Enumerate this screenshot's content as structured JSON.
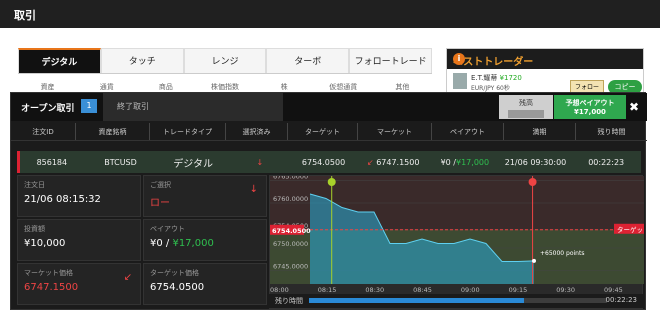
{
  "page": {
    "title": "取引"
  },
  "tabs": [
    "デジタル",
    "タッチ",
    "レンジ",
    "ターボ",
    "フォロートレード"
  ],
  "subheaders": [
    "資産",
    "通貨",
    "商品",
    "株価指数",
    "株",
    "仮想通貨",
    "其他"
  ],
  "best_trader": {
    "title": "ベストトレーダー",
    "info": "i",
    "name": "E.T.耀蒂",
    "amount": "¥1720",
    "pair": "EUR/JPY 60秒",
    "follow_label": "フォロー",
    "copy_label": "コピー"
  },
  "panel": {
    "open_tab": "オープン取引",
    "open_count": "1",
    "closed_tab": "終了取引",
    "balance_label": "残高",
    "payout_label": "予想ペイアウト",
    "payout_value": "¥17,000",
    "close_icon": "✖",
    "columns": [
      "注文ID",
      "資産銘柄",
      "トレードタイプ",
      "選択済み",
      "ターゲット",
      "マーケット",
      "ペイアウト",
      "満期",
      "残り時間"
    ],
    "row": {
      "id": "856184",
      "asset": "BTCUSD",
      "type": "デジタル",
      "direction": "↓",
      "target": "6754.0500",
      "market_arrow": "↙",
      "market": "6747.1500",
      "payout_a": "¥0 / ",
      "payout_b": "¥17,000",
      "expiry": "21/06 09:30:00",
      "remaining": "00:22:23"
    },
    "details": {
      "order_date_label": "注文日",
      "order_date": "21/06 08:15:32",
      "choice_label": "ご選択",
      "choice": "ロー",
      "invest_label": "投資額",
      "invest": "¥10,000",
      "payout_label": "ペイアウト",
      "payout_a": "¥0 / ",
      "payout_b": "¥17,000",
      "market_label": "マーケット価格",
      "market": "6747.1500",
      "target_label": "ターゲット価格",
      "target": "6754.0500"
    },
    "chart": {
      "y_labels": [
        "6765.0000",
        "6760.0000",
        "6754.0500",
        "6750.0000",
        "6745.0000"
      ],
      "x_labels": [
        "08:00",
        "08:15",
        "08:30",
        "08:45",
        "09:00",
        "09:15",
        "09:30",
        "09:45"
      ],
      "target_tag": "ターゲット",
      "annotation": "+65000 points",
      "accent": "#2aa4c9"
    },
    "remaining_label": "残り時間",
    "remaining_value": "00:22:23",
    "progress": 0.72
  },
  "chart_data": {
    "type": "line",
    "title": "",
    "x": [
      "08:00",
      "08:05",
      "08:10",
      "08:15",
      "08:20",
      "08:25",
      "08:30",
      "08:35",
      "08:40",
      "08:45",
      "08:50",
      "08:55",
      "09:00",
      "09:05",
      "09:07"
    ],
    "series": [
      {
        "values": [
          6762,
          6761,
          6759,
          6758,
          6758,
          6751,
          6751,
          6752,
          6751,
          6751,
          6752,
          6751,
          6747,
          6747,
          6747.15
        ]
      }
    ],
    "ylim": [
      6742,
      6766
    ],
    "xlabel": "",
    "ylabel": "",
    "target": 6754.05
  }
}
